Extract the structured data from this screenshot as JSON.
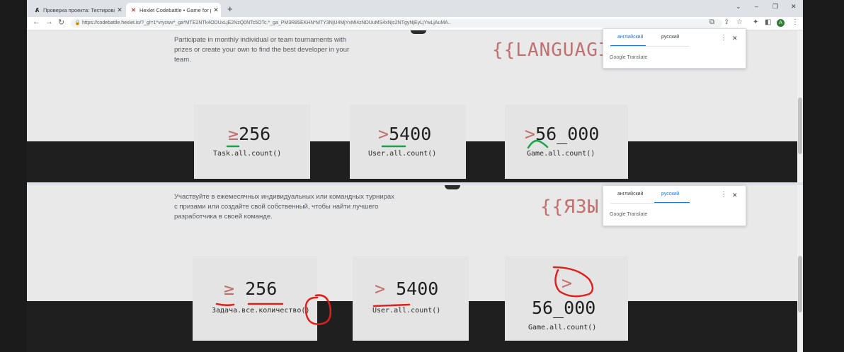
{
  "browser": {
    "tabs": [
      {
        "title": "Проверка проекта: Тестирован",
        "icon": "hexlet-icon"
      },
      {
        "title": "Hexlet Codebattle • Game for p",
        "icon": "codebattle-icon"
      }
    ],
    "new_tab": "+",
    "address": "https://codebattle.hexlet.io/?_gl=1*vrycwv*_ga*MTE2NTk4ODUxLjE2NzQ0NTc5OTc.*_ga_PM3R85EKHN*MTY3NjU4MjYxMi4zNDUuMS4xNjc2NTgyNjEyLjYwLjAuMA..",
    "avatar": "A",
    "win": {
      "min": "⌄",
      "minimize": "–",
      "restore": "❐",
      "close": "✕"
    }
  },
  "top": {
    "description": [
      "Participate in monthly individual or team tournaments with",
      "prizes or create your own to find the best developer in your",
      "team."
    ],
    "language_banner": "{{LANGUAGI",
    "stats": [
      {
        "symbol": "≥",
        "value": "256",
        "code": "Task.all.count()"
      },
      {
        "symbol": ">",
        "value": "5400",
        "code": "User.all.count()"
      },
      {
        "symbol": ">",
        "value": "56_000",
        "code": "Game.all.count()"
      }
    ],
    "translate": {
      "lang_from": "английский",
      "lang_to": "русский",
      "selected": "английский",
      "brand": "Google",
      "product": "Translate",
      "menu": "⋮",
      "close": "✕"
    }
  },
  "bottom": {
    "description": [
      "Участвуйте в ежемесячных индивидуальных или командных турнирах",
      "с призами или создайте свой собственный, чтобы найти лучшего",
      "разработчика в своей команде."
    ],
    "language_banner": "{{ЯЗЫ",
    "stats": [
      {
        "symbol": "≥",
        "value": "256",
        "code": "Задача.все.количество()"
      },
      {
        "symbol": ">",
        "value": "5400",
        "code": "User.all.count()"
      },
      {
        "symbol": ">",
        "value": "56_000",
        "code": "Game.all.count()"
      }
    ],
    "translate": {
      "lang_from": "английский",
      "lang_to": "русский",
      "selected": "русский",
      "brand": "Google",
      "product": "Translate",
      "menu": "⋮",
      "close": "✕"
    }
  }
}
